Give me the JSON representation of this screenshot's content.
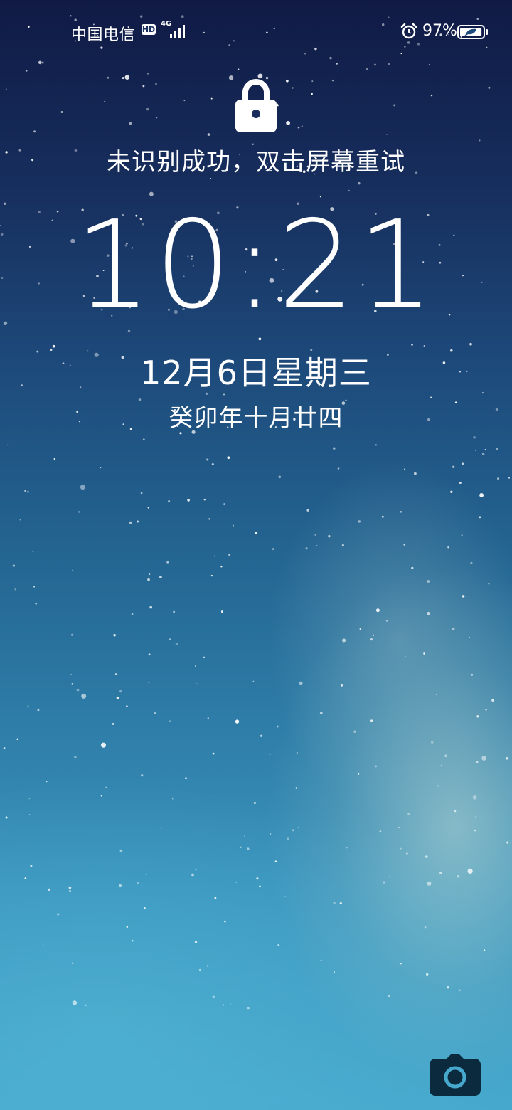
{
  "status_bar": {
    "carrier": "中国电信",
    "hd_badge": "HD",
    "network_type": "4G",
    "signal_icon": "signal-bars-icon",
    "alarm_icon": "alarm-clock-icon",
    "battery_percent": "97%",
    "battery_level": 0.97,
    "battery_icon": "battery-leaf-icon"
  },
  "lock": {
    "icon": "lock-icon",
    "hint": "未识别成功，双击屏幕重试"
  },
  "clock": {
    "time": "10:21",
    "date": "12月6日星期三",
    "lunar_date": "癸卯年十月廿四"
  },
  "shortcuts": {
    "camera_icon": "camera-icon"
  },
  "colors": {
    "text": "#ffffff",
    "sky_top": "#101a45",
    "sky_bottom": "#46a8cc"
  }
}
